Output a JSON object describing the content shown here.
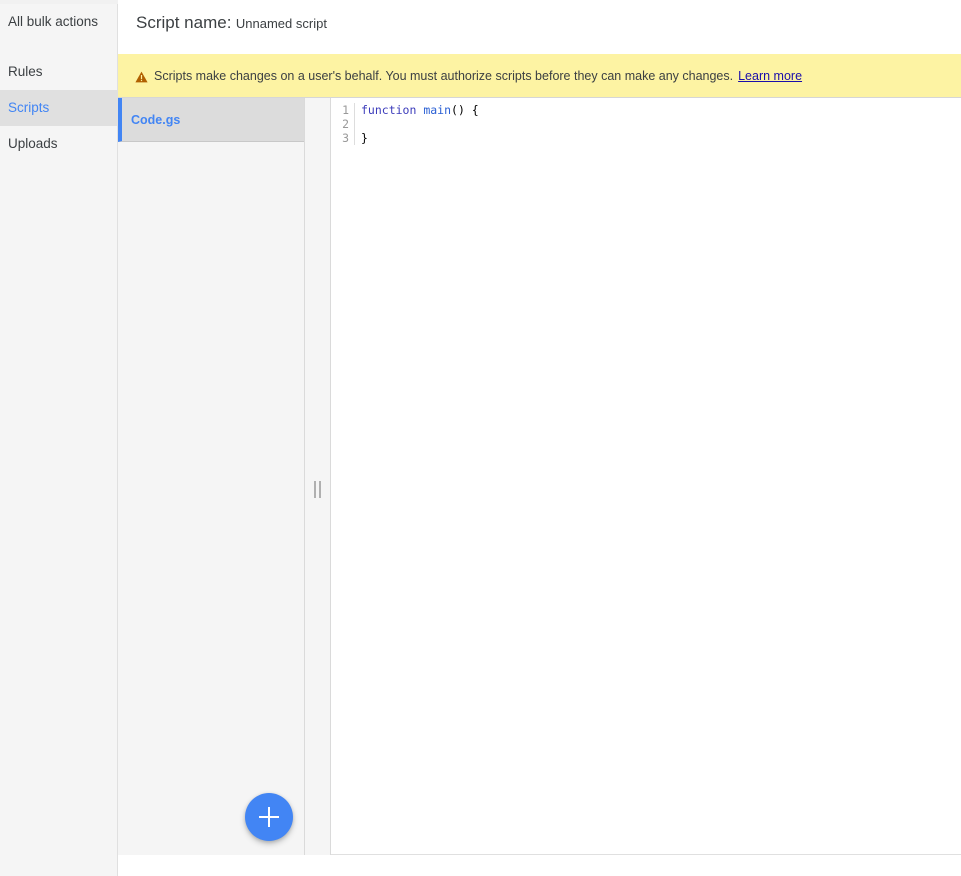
{
  "sidebar": {
    "items": [
      {
        "label": "All bulk actions",
        "selected": false
      },
      {
        "label": "Rules",
        "selected": false
      },
      {
        "label": "Scripts",
        "selected": true
      },
      {
        "label": "Uploads",
        "selected": false
      }
    ]
  },
  "header": {
    "script_name_label": "Script name:",
    "script_name_value": "Unnamed script"
  },
  "banner": {
    "icon": "warning-triangle-icon",
    "text": "Scripts make changes on a user's behalf. You must authorize scripts before they can make any changes.",
    "link_label": "Learn more",
    "background_color": "#fdf3a3",
    "icon_color": "#b06000",
    "link_color": "#1a0dab"
  },
  "file_panel": {
    "files": [
      {
        "name": "Code.gs",
        "selected": true
      }
    ],
    "add_button": {
      "icon": "plus-icon",
      "label": "+",
      "color": "#4285f4"
    }
  },
  "splitter": {
    "icon": "drag-handle-icon"
  },
  "editor": {
    "language": "javascript",
    "lines": [
      {
        "number": "1",
        "tokens": [
          {
            "text": "function ",
            "type": "keyword"
          },
          {
            "text": "main",
            "type": "function"
          },
          {
            "text": "() {",
            "type": "punctuation"
          }
        ]
      },
      {
        "number": "2",
        "tokens": []
      },
      {
        "number": "3",
        "tokens": [
          {
            "text": "}",
            "type": "punctuation"
          }
        ]
      }
    ]
  },
  "colors": {
    "accent": "#4285f4",
    "sidebar_bg": "#f5f5f5",
    "selected_bg": "#e0e0e0",
    "file_selected_bg": "#dcdcdc"
  }
}
